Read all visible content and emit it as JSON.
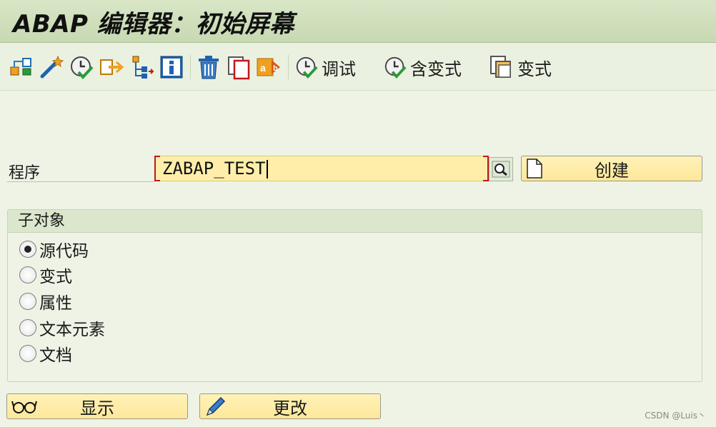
{
  "window": {
    "title": "ABAP 编辑器：初始屏幕"
  },
  "toolbar": {
    "icons": [
      "hierarchy-icon",
      "magic-wand-icon",
      "execute-check-icon",
      "export-icon",
      "where-used-icon",
      "info-icon",
      "delete-icon",
      "copy-icon",
      "rename-icon"
    ],
    "debug_label": "调试",
    "with_variant_label": "含变式",
    "variant_label": "变式"
  },
  "form": {
    "program_label": "程序",
    "program_value": "ZABAP_TEST",
    "create_label": "创建"
  },
  "subobjects": {
    "title": "子对象",
    "options": [
      "源代码",
      "变式",
      "属性",
      "文本元素",
      "文档"
    ],
    "selected": "源代码"
  },
  "actions": {
    "display_label": "显示",
    "change_label": "更改"
  },
  "watermark": "CSDN @Luis丶",
  "colors": {
    "title_bar": "#c7d9b2",
    "field_bg": "#ffeeaa",
    "button_bg": "#fde79a",
    "required_marker": "#c0181b"
  }
}
